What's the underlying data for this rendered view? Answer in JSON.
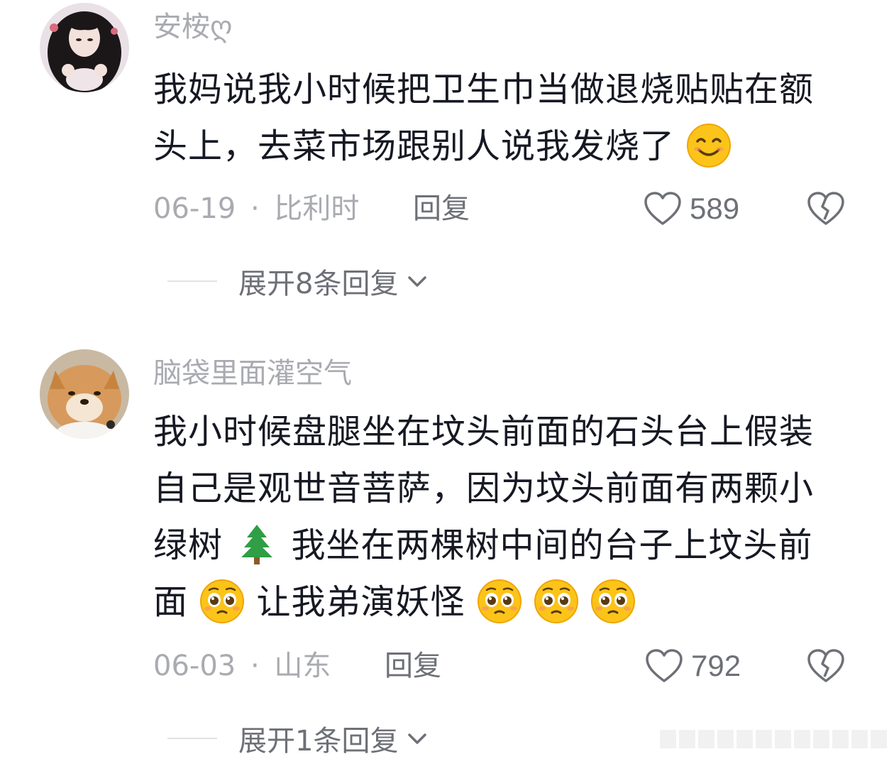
{
  "comments": [
    {
      "username": "安桉ღ",
      "lines": [
        "我妈说我小时候把卫生巾当做退烧贴贴在额",
        "头上，去菜市场跟别人说我发烧了"
      ],
      "line2_emoji": "smiling-face-with-smiling-eyes",
      "date": "06-19",
      "separator": "·",
      "location": "比利时",
      "reply_label": "回复",
      "likes": "589",
      "expand_label": "展开8条回复"
    },
    {
      "username": "脑袋里面灌空气",
      "lines": [
        "我小时候盘腿坐在坟头前面的石头台上假装",
        "自己是观世音菩萨，因为坟头前面有两颗小",
        "绿树",
        "我坐在两棵树中间的台子上坟头前",
        "面",
        "让我弟演妖怪"
      ],
      "tree_emoji": "evergreen-tree",
      "pleading_emoji": "pleading-face",
      "date": "06-03",
      "separator": "·",
      "location": "山东",
      "reply_label": "回复",
      "likes": "792",
      "expand_label": "展开1条回复"
    }
  ],
  "icons": {
    "like": "heart-outline-icon",
    "dislike": "broken-heart-icon",
    "expand": "chevron-down-icon"
  },
  "colors": {
    "text_primary": "#161823",
    "text_secondary": "#a9abb0",
    "text_action": "#6e7077",
    "divider": "#e3e3e4",
    "emoji_yellow": "#fcc419"
  }
}
